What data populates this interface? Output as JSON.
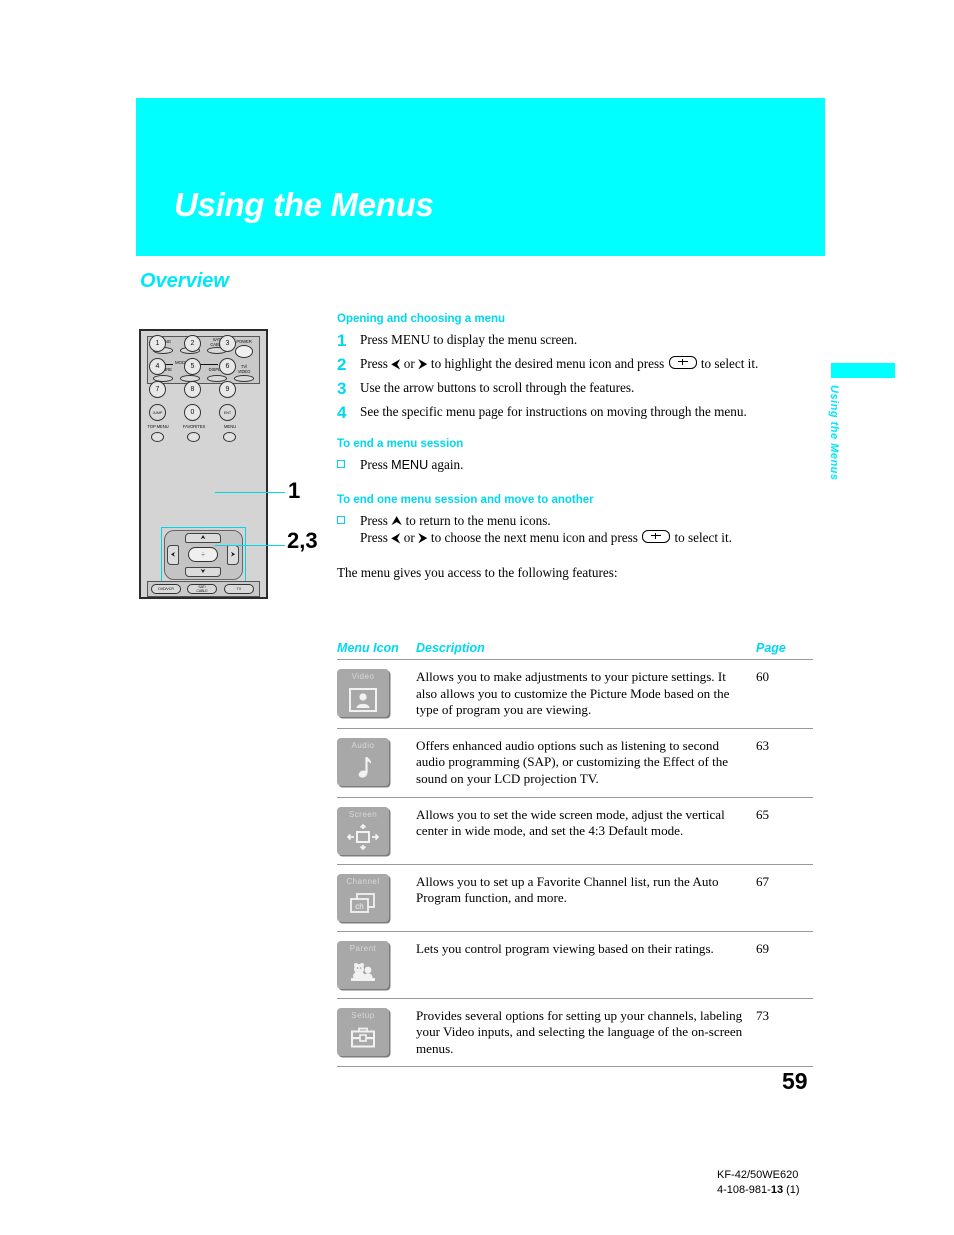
{
  "chapter": {
    "title": "Using the Menus",
    "section_heading": "Overview",
    "side_tab_label": "Using the Menus"
  },
  "colors": {
    "cyan": "#00FFFF",
    "heading_cyan": "#00E8F5",
    "tile_gray": "#a8a8a8"
  },
  "procedures": {
    "opening": {
      "heading": "Opening and choosing a menu",
      "steps": [
        {
          "num": "1",
          "pre": "Press MENU to display the menu screen.",
          "post": ""
        },
        {
          "num": "2",
          "pre": "Press ⮜ or ⮞ to highlight the desired menu icon and press",
          "post": "to select it."
        },
        {
          "num": "3",
          "pre": "Use the arrow buttons to scroll through the features.",
          "post": ""
        },
        {
          "num": "4",
          "pre": "See the specific menu page for instructions on moving through the menu.",
          "post": ""
        }
      ]
    },
    "end_session": {
      "heading": "To end a menu session",
      "bullet_pre": "Press ",
      "bullet_menu": "MENU",
      "bullet_post": " again."
    },
    "switch_session": {
      "heading": "To end one menu session and move to another",
      "line1": "Press ⮝ to return to the menu icons.",
      "line2_pre": "Press ⮜ or ⮞ to choose the next menu icon and press",
      "line2_post": "to select it."
    },
    "intro_line": "The menu gives you access to the following features:"
  },
  "table": {
    "headers": {
      "icon": "Menu Icon",
      "description": "Description",
      "page": "Page"
    },
    "rows": [
      {
        "icon_label": "Video",
        "icon_art": "person-silhouette",
        "description": "Allows you to make adjustments to your picture settings. It also allows you to customize the Picture Mode based on the type of program you are viewing.",
        "page": "60"
      },
      {
        "icon_label": "Audio",
        "icon_art": "music-note",
        "description": "Offers enhanced audio options such as listening to second audio programming (SAP), or customizing the Effect of the sound on your LCD projection TV.",
        "page": "63"
      },
      {
        "icon_label": "Screen",
        "icon_art": "resize-arrows",
        "description": "Allows you to set the wide screen mode, adjust the vertical center in wide mode, and set the 4:3 Default mode.",
        "page": "65"
      },
      {
        "icon_label": "Channel",
        "icon_art": "stacked-ch-cards",
        "description": "Allows you to set up a Favorite Channel list, run the Auto Program function, and more.",
        "page": "67"
      },
      {
        "icon_label": "Parent",
        "icon_art": "parental-bear",
        "description": "Lets you control program viewing based on their ratings.",
        "page": "69"
      },
      {
        "icon_label": "Setup",
        "icon_art": "toolbox",
        "description": "Provides several options for setting up your channels, labeling your Video inputs, and selecting the language of the on-screen menus.",
        "page": "73"
      }
    ]
  },
  "remote": {
    "callouts": [
      {
        "label": "1"
      },
      {
        "label": "2,3"
      }
    ],
    "top_row": [
      {
        "label": "MUTING"
      },
      {
        "label": "DVD/\nVCR"
      },
      {
        "label": "SAT/\nCABLE"
      },
      {
        "label": "POWER"
      }
    ],
    "mode_divider": "MODE",
    "mode_row": [
      {
        "label": "PICTURE"
      },
      {
        "label": "WIDE"
      },
      {
        "label": "DISPLAY"
      },
      {
        "label": "TV/\nVIDEO"
      }
    ],
    "keypad": [
      "1",
      "2",
      "3",
      "4",
      "5",
      "6",
      "7",
      "8",
      "9",
      "JUMP",
      "0",
      "ENT"
    ],
    "menu_row": [
      {
        "label": "TOP MENU"
      },
      {
        "label": "FAVORITES"
      },
      {
        "label": "MENU"
      }
    ],
    "dpad": {
      "up": "⮝",
      "down": "⮟",
      "left": "⮜",
      "right": "⮞",
      "center": "÷"
    },
    "bottom_row": [
      {
        "label": "DVD/VCR"
      },
      {
        "label": "SAT/\nCABLE"
      },
      {
        "label": "TV"
      }
    ]
  },
  "footer": {
    "page_number": "59",
    "model": "KF-42/50WE620",
    "doc_prefix": "4-108-981-",
    "doc_bold": "13",
    "doc_suffix": " (1)"
  }
}
